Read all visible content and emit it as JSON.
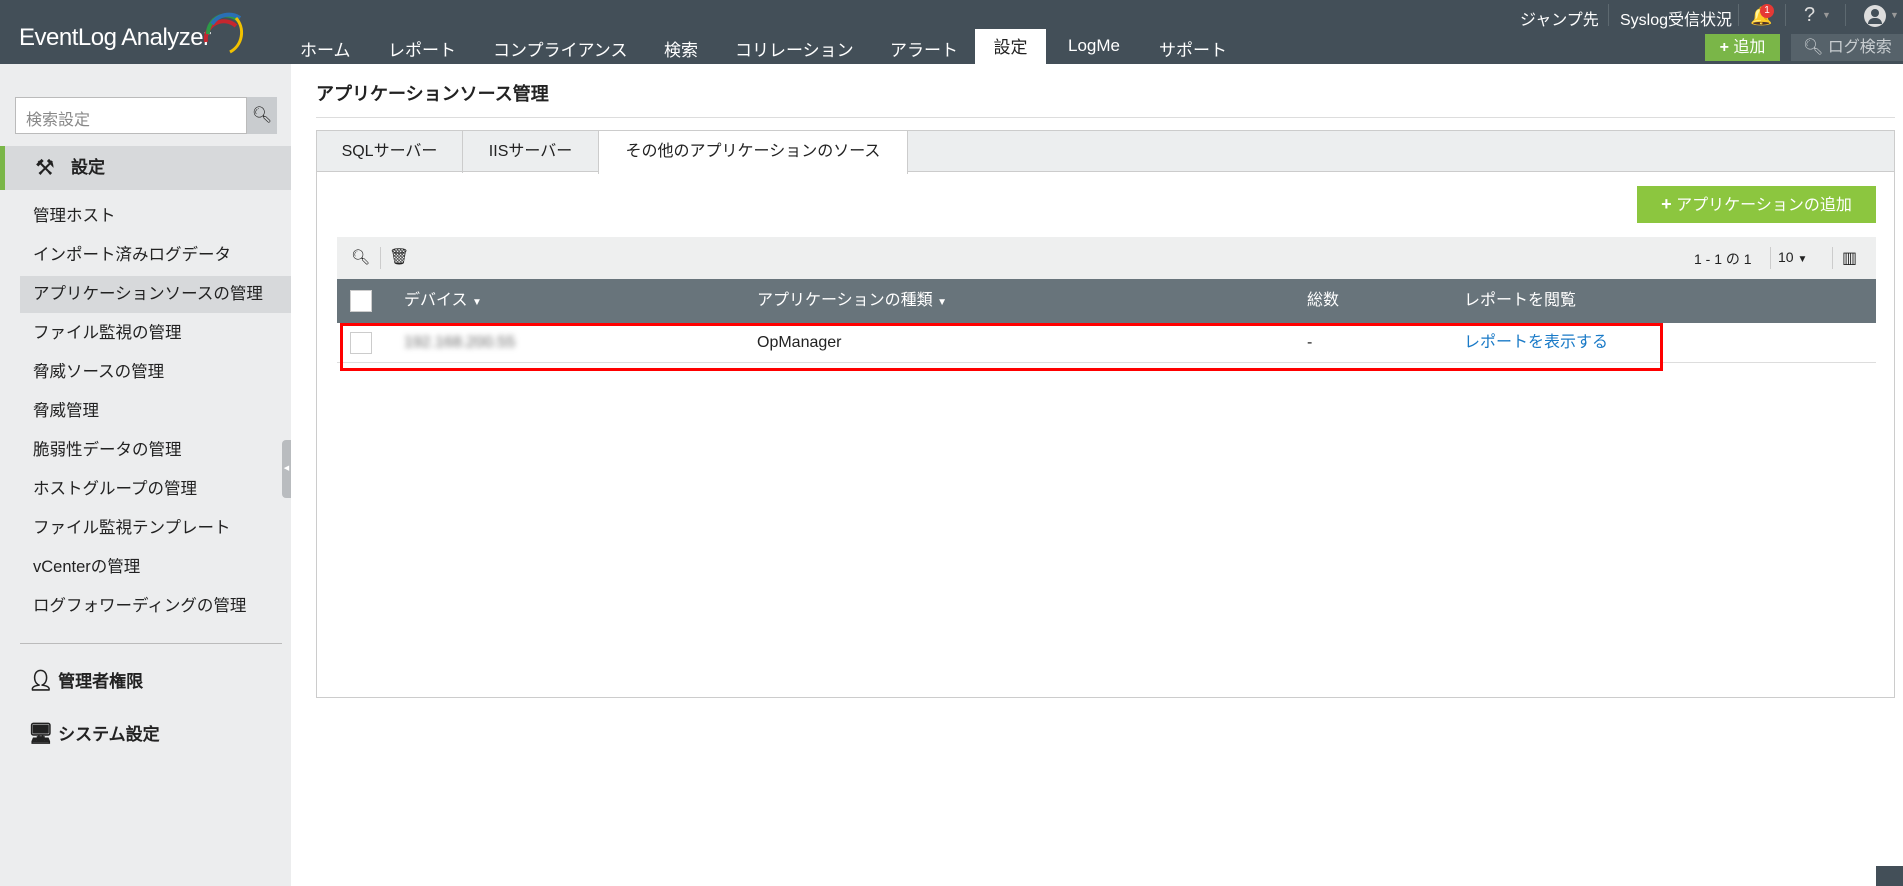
{
  "header": {
    "logo": "EventLog Analyzer",
    "nav": [
      "ホーム",
      "レポート",
      "コンプライアンス",
      "検索",
      "コリレーション",
      "アラート",
      "設定",
      "LogMe",
      "サポート"
    ],
    "active_nav": "設定",
    "jump": "ジャンプ先",
    "syslog": "Syslog受信状況",
    "notif_count": "1",
    "help": "?",
    "add": "追加",
    "log_search": "ログ検索"
  },
  "sidebar": {
    "search_placeholder": "検索設定",
    "section": "設定",
    "items": [
      "管理ホスト",
      "インポート済みログデータ",
      "アプリケーションソースの管理",
      "ファイル監視の管理",
      "脅威ソースの管理",
      "脅威管理",
      "脆弱性データの管理",
      "ホストグループの管理",
      "ファイル監視テンプレート",
      "vCenterの管理",
      "ログフォワーディングの管理"
    ],
    "admin": "管理者権限",
    "system": "システム設定"
  },
  "main": {
    "title": "アプリケーションソース管理",
    "tabs": [
      "SQLサーバー",
      "IISサーバー",
      "その他のアプリケーションのソース"
    ],
    "add_app": "アプリケーションの追加",
    "pagination": "1 - 1 の 1",
    "page_size": "10",
    "columns": [
      "デバイス",
      "アプリケーションの種類",
      "総数",
      "レポートを閲覧"
    ],
    "rows": [
      {
        "device": "192.168.200.55",
        "app_type": "OpManager",
        "total": "-",
        "report": "レポートを表示する"
      }
    ]
  },
  "colors": {
    "topbar": "#434f58",
    "accent": "#7ab648",
    "link": "#1a7ac7",
    "highlight": "#ff0000"
  }
}
